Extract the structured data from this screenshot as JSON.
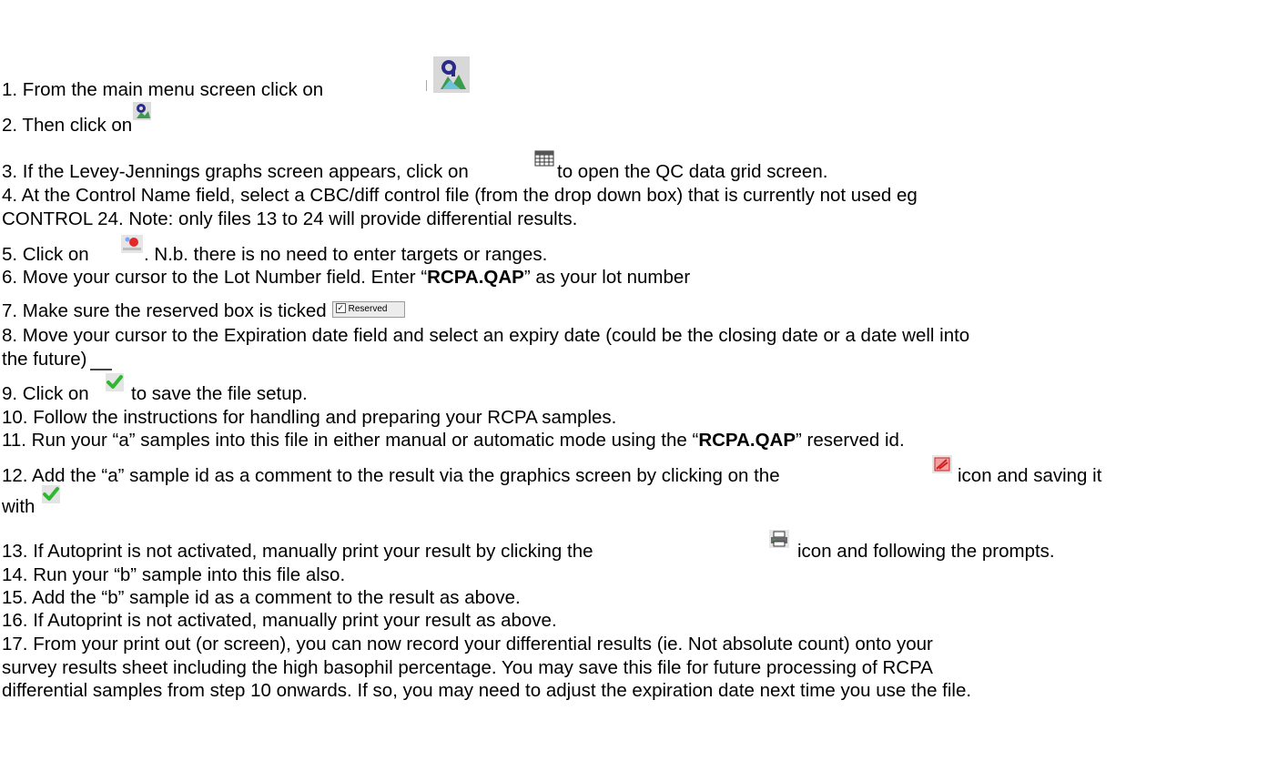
{
  "steps": {
    "s1": "1. From the main menu screen click on",
    "s2": "2. Then click on",
    "s3_a": "3. If the Levey-Jennings graphs screen appears, click on",
    "s3_b": "to open the QC data grid screen.",
    "s4_a": "4. At the Control Name field, select a CBC/diff control file (from the drop down box) that is currently not used eg",
    "s4_b": "CONTROL 24. Note: only files 13 to 24 will provide differential results.",
    "s5_a": "5. Click on",
    "s5_b": ". N.b. there is no need to enter targets or ranges.",
    "s6_a": "6. Move your cursor to the Lot Number field. Enter “",
    "s6_lot": "RCPA.QAP",
    "s6_b": "” as your lot number",
    "s7": "7. Make sure the reserved box is ticked",
    "s7_box": "Reserved",
    "s8_a": "8. Move your cursor to the Expiration date field and select an expiry date (could be the closing date or a date well into",
    "s8_b": "the future)",
    "s9_a": "9. Click on",
    "s9_b": "to save the file setup.",
    "s10": "10. Follow the instructions for handling and preparing your RCPA samples.",
    "s11_a": "11. Run your “a” samples into this file in either manual or automatic mode using the “",
    "s11_id": "RCPA.QAP",
    "s11_b": "” reserved id.",
    "s12_a": "12. Add the “a” sample id as a comment to the result via the graphics screen by clicking on the",
    "s12_b": "icon and saving it",
    "s12_c": "with",
    "s13_a": "13. If Autoprint is not activated, manually print your result by clicking the",
    "s13_b": "icon and following the prompts.",
    "s14": "14. Run your “b” sample into this file also.",
    "s15": "15. Add the “b” sample id as a comment to the result as above.",
    "s16": "16. If Autoprint is not activated, manually print your result as above.",
    "s17_a": "17. From your print out (or screen), you can now record your differential results (ie. Not absolute count) onto your",
    "s17_b": "survey results sheet including the high basophil percentage.  You may save this file for future processing of RCPA",
    "s17_c": "differential samples from step 10 onwards. If  so, you may need to adjust the expiration date next time you use the file."
  },
  "icons": {
    "qc_main": "qc-main-menu-icon",
    "qc_sub": "qc-submenu-icon",
    "grid": "data-grid-icon",
    "new_file": "new-file-icon",
    "checkmark": "checkmark-save-icon",
    "comment": "comment-icon",
    "print": "print-icon"
  }
}
